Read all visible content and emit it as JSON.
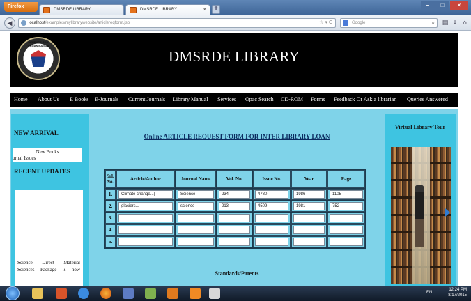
{
  "browser": {
    "app_button": "Firefox",
    "tabs": [
      {
        "label": "DMSRDE LIBRARY"
      },
      {
        "label": "DMSRDE LIBRARY"
      }
    ],
    "url_host": "localhost",
    "url_path": "/examples/mylibrarywebsite/articlereqform.jsp",
    "search_placeholder": "Google"
  },
  "site": {
    "title": "DMSRDE LIBRARY",
    "logo_ring_text": "DEFENCE R&D ORGANISATION"
  },
  "menu": [
    "Home",
    "About Us",
    "E Books",
    "E-Journals",
    "Current Journals",
    "Library Manual",
    "Services",
    "Opac Search",
    "CD-ROM",
    "Forms",
    "Feedback Or Ask a librarian",
    "Queries Answered"
  ],
  "left": {
    "new_arrival_heading": "NEW ARRIVAL",
    "new_arrival_items": [
      "New Books",
      "urnal Issues"
    ],
    "recent_updates_heading": "RECENT UPDATES",
    "recent_updates_text": "Science Direct Material Sciences Package is now"
  },
  "form": {
    "title": "Online ARTICLE REQUEST FORM FOR INTER LIBRARY LOAN",
    "headers": [
      "Srl. No.",
      "Article/Author",
      "Journal Name",
      "Vol. No.",
      "Issue No.",
      "Year",
      "Page"
    ],
    "rows": [
      {
        "sn": "1.",
        "article": "Climate change...|",
        "journal": "Science",
        "vol": "234",
        "issue": "4780",
        "year": "1986",
        "page": "1105"
      },
      {
        "sn": "2.",
        "article": "glaciers...",
        "journal": "science",
        "vol": "213",
        "issue": "4509",
        "year": "1981",
        "page": "752"
      },
      {
        "sn": "3.",
        "article": "",
        "journal": "",
        "vol": "",
        "issue": "",
        "year": "",
        "page": ""
      },
      {
        "sn": "4.",
        "article": "",
        "journal": "",
        "vol": "",
        "issue": "",
        "year": "",
        "page": ""
      },
      {
        "sn": "5.",
        "article": "",
        "journal": "",
        "vol": "",
        "issue": "",
        "year": "",
        "page": ""
      }
    ],
    "standards_heading": "Standards/Patents"
  },
  "right": {
    "tour_heading": "Virtual Library Tour"
  },
  "taskbar": {
    "lang": "EN",
    "time": "12:24 PM",
    "date": "8/17/2015"
  }
}
